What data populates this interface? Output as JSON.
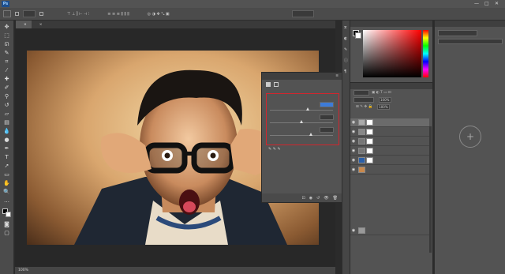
{
  "app": {
    "logo": "Ps"
  },
  "menu": [],
  "window_controls": [
    "—",
    "□",
    "✕"
  ],
  "options_bar": {},
  "doc_tabs": [],
  "statusbar": {
    "zoom": "100%"
  },
  "properties": {
    "tabs": [],
    "sliders": [
      {
        "value": "",
        "selected": true
      },
      {
        "value": ""
      },
      {
        "value": ""
      }
    ],
    "footer_icons": [
      "clip-icon",
      "eye-toggle-icon",
      "reset-icon",
      "visibility-icon",
      "trash-icon"
    ]
  },
  "color_panel": {
    "tabs": [],
    "fg": "#000000",
    "bg": "#ffffff"
  },
  "layers": {
    "tabs": [],
    "blend_mode": "",
    "opacity_label": "",
    "opacity": "100%",
    "lock_label": "",
    "fill_label": "",
    "fill": "100%",
    "rows": [
      {
        "name": "",
        "selected": true
      },
      {
        "name": ""
      },
      {
        "name": ""
      },
      {
        "name": ""
      },
      {
        "name": ""
      },
      {
        "name": ""
      },
      {
        "name": ""
      }
    ],
    "sub_rows": [
      "",
      "",
      "",
      "",
      "",
      "",
      "",
      "",
      "",
      "",
      "",
      "",
      "",
      "",
      "",
      ""
    ]
  },
  "libraries": {
    "search_placeholder": "",
    "title": "",
    "link": ""
  }
}
